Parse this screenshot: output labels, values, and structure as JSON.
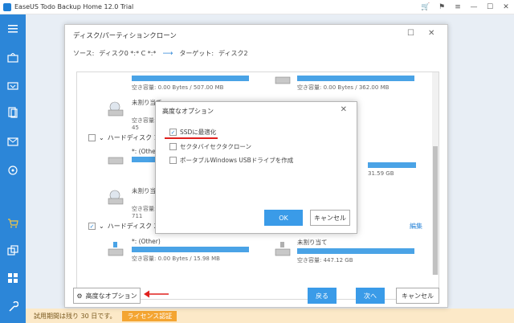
{
  "app": {
    "title": "EaseUS Todo Backup Home 12.0 Trial",
    "controls": [
      "🛒",
      "⚑",
      "≡",
      "—",
      "☐",
      "✕"
    ]
  },
  "sidebar": {
    "items": [
      "menu-icon",
      "backup-icon",
      "restore-icon",
      "files-icon",
      "email-icon",
      "target-icon",
      "cart-icon",
      "clone-icon",
      "tools-icon",
      "wrench-icon"
    ]
  },
  "trial": {
    "text": "試用期間は残り 30 日です。",
    "link": "ライセンス認証"
  },
  "clone_dialog": {
    "title": "ディスク/パーティションクローン",
    "source_label": "ソース:",
    "source_value": "ディスク0 *:* C *:*",
    "target_label": "ターゲット:",
    "target_value": "ディスク2",
    "partitions_top": [
      {
        "cap": "空き容量: 0.00 Bytes / 507.00 MB"
      },
      {
        "cap": "空き容量: 0.00 Bytes / 362.00 MB"
      }
    ],
    "unalloc_1": {
      "name": "未割り当て",
      "cap": "空き容量: 45"
    },
    "disk1": {
      "label": "ハードディスク 1 (",
      "checked": false
    },
    "disk1_parts": [
      {
        "name": "*: (Other",
        "cap": ""
      },
      {
        "cap": "31.59 GB"
      }
    ],
    "unalloc_2": {
      "name": "未割り当て",
      "cap": "空き容量: 711"
    },
    "disk2": {
      "label": "ハードディスク 2 (",
      "checked": true
    },
    "edit_link": "編集",
    "disk2_parts": [
      {
        "name": "*: (Other)",
        "cap": "空き容量: 0.00 Bytes / 15.98 MB"
      },
      {
        "name": "未割り当て",
        "cap": "空き容量: 447.12 GB"
      }
    ],
    "advanced_button": "高度なオプション",
    "back_button": "戻る",
    "next_button": "次へ",
    "cancel_button": "キャンセル"
  },
  "adv_dialog": {
    "title": "高度なオプション",
    "options": [
      {
        "label": "SSDに最適化",
        "checked": true
      },
      {
        "label": "セクタバイセクタクローン",
        "checked": false
      },
      {
        "label": "ポータブルWindows USBドライブを作成",
        "checked": false
      }
    ],
    "ok_button": "OK",
    "cancel_button": "キャンセル"
  },
  "colors": {
    "accent": "#2c86d8",
    "bar": "#4aa3e6",
    "highlight": "#e0201e"
  }
}
